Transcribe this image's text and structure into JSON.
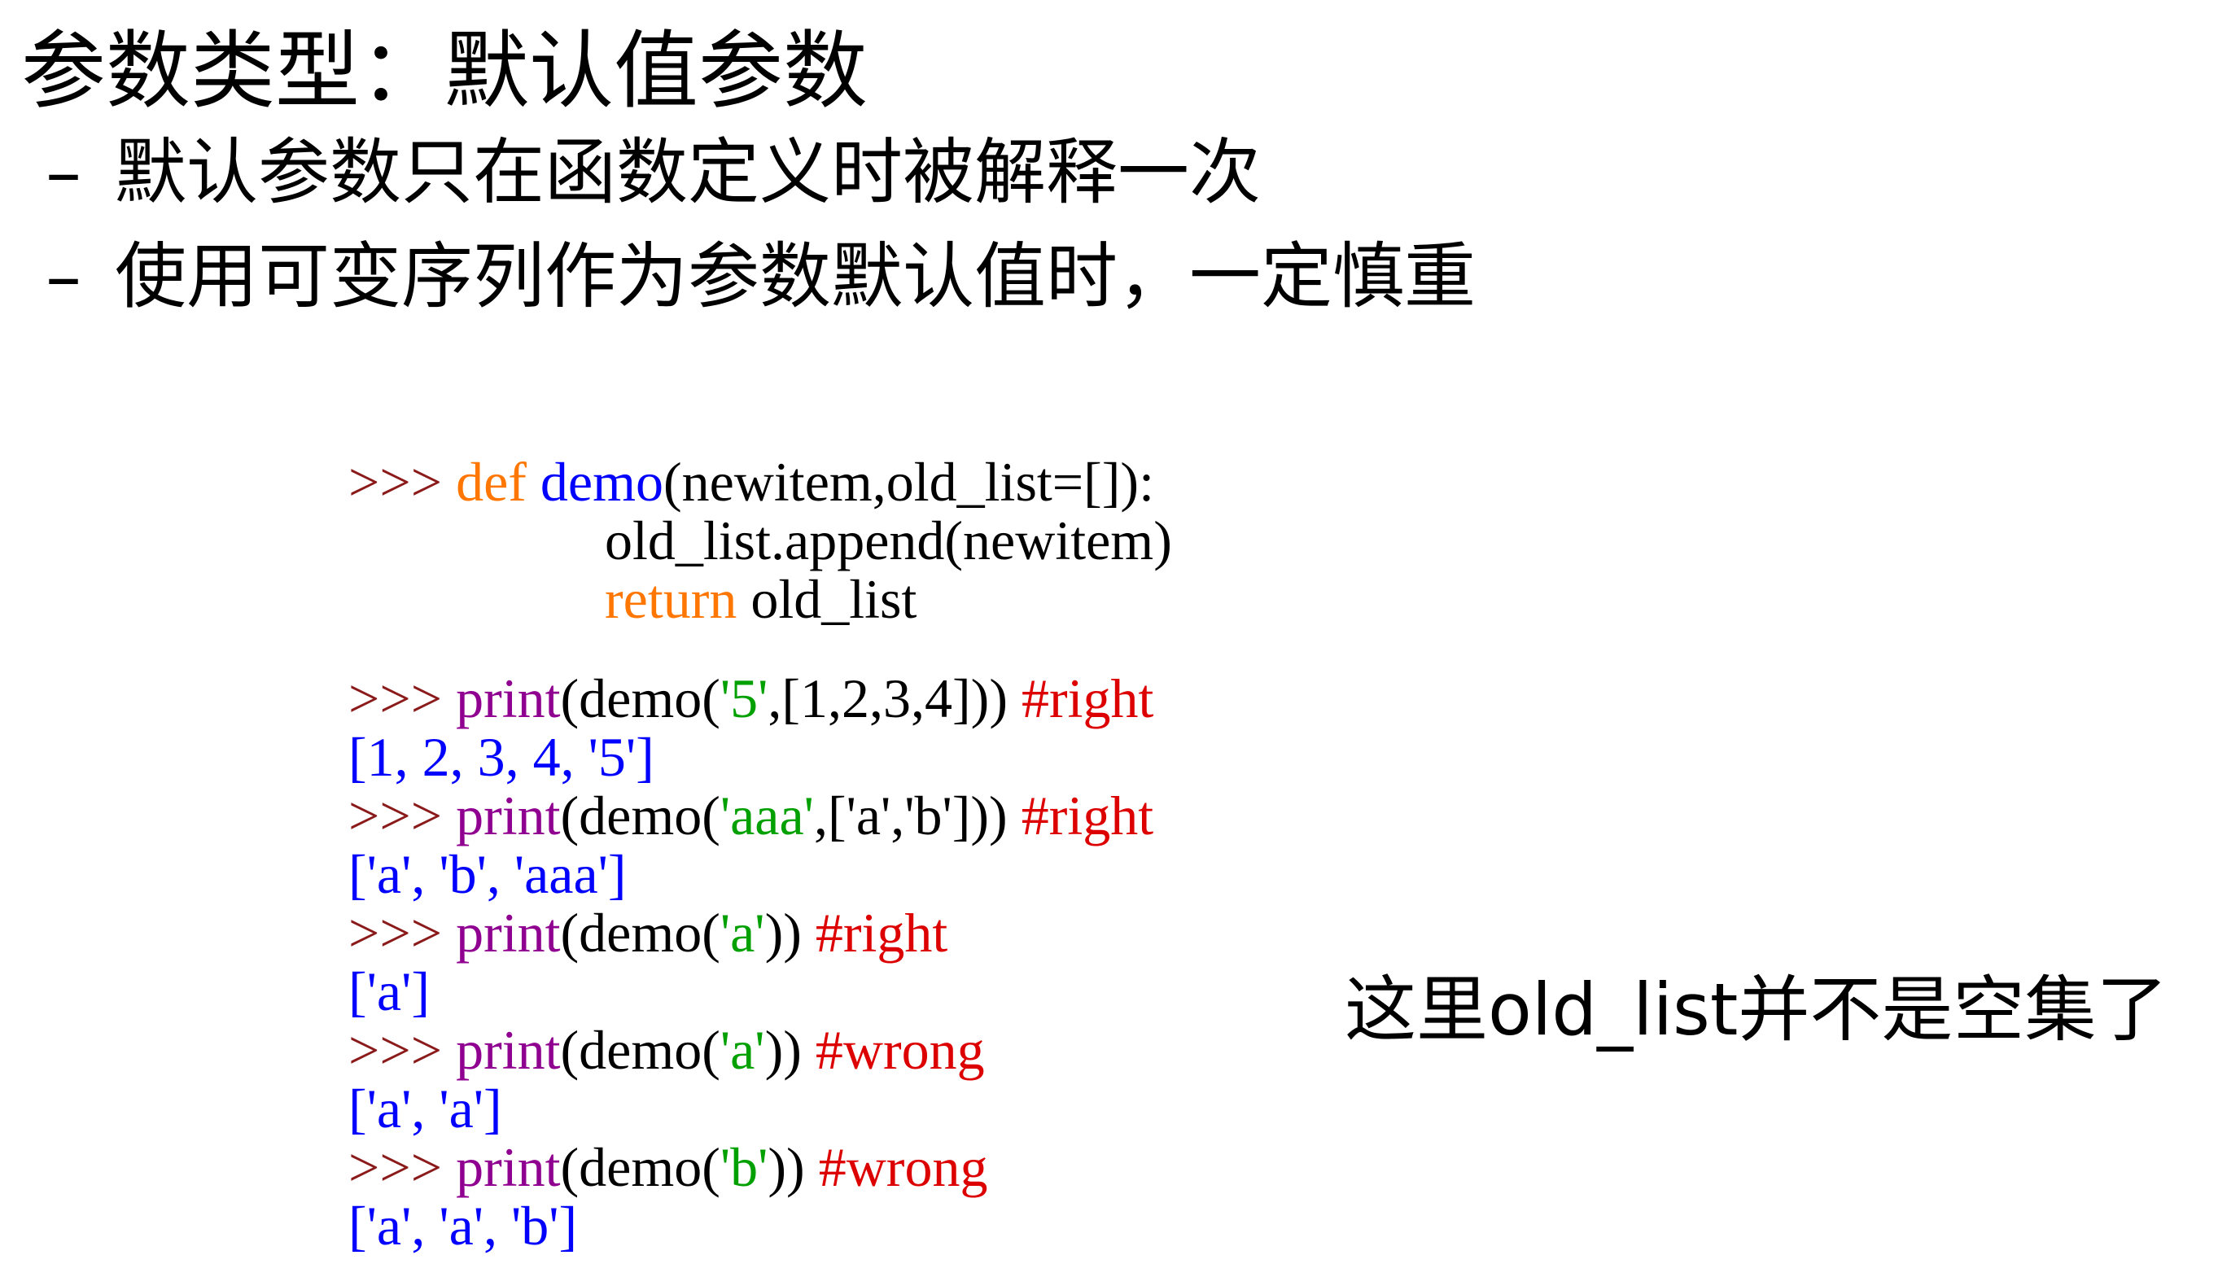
{
  "title": "参数类型：默认值参数",
  "bullets": [
    {
      "dash": "–",
      "text": "默认参数只在函数定义时被解释一次"
    },
    {
      "dash": "–",
      "text": "使用可变序列作为参数默认值时，一定慎重"
    }
  ],
  "code": {
    "prompt": ">>> ",
    "line1": {
      "kw": "def",
      "sp": " ",
      "fn": "demo",
      "rest": "(newitem,old_list=[]):"
    },
    "line2": {
      "text": "old_list.append(newitem)"
    },
    "line3": {
      "kw": "return",
      "rest": " old_list"
    },
    "calls": [
      {
        "print": "print",
        "pre": "(demo(",
        "str": "'5'",
        "mid": ",[1,2,3,4])) ",
        "comment": "#right",
        "output": "[1, 2, 3, 4, '5']"
      },
      {
        "print": "print",
        "pre": "(demo(",
        "str": "'aaa'",
        "mid": ",['a','b'])) ",
        "comment": "#right",
        "output": "['a', 'b', 'aaa']"
      },
      {
        "print": "print",
        "pre": "(demo(",
        "str": "'a'",
        "mid": ")) ",
        "comment": "#right",
        "output": "['a']"
      },
      {
        "print": "print",
        "pre": "(demo(",
        "str": "'a'",
        "mid": ")) ",
        "comment": "#wrong",
        "output": "['a', 'a']"
      },
      {
        "print": "print",
        "pre": "(demo(",
        "str": "'b'",
        "mid": ")) ",
        "comment": "#wrong",
        "output": "['a', 'a', 'b']"
      }
    ]
  },
  "note": "这里old_list并不是空集了",
  "colors": {
    "prompt": "#8b1a1a",
    "keyword": "#ff7700",
    "funcname": "#0000ff",
    "builtin": "#900090",
    "string": "#00a000",
    "comment": "#dd0000",
    "output": "#0000ff",
    "text": "#000000"
  }
}
